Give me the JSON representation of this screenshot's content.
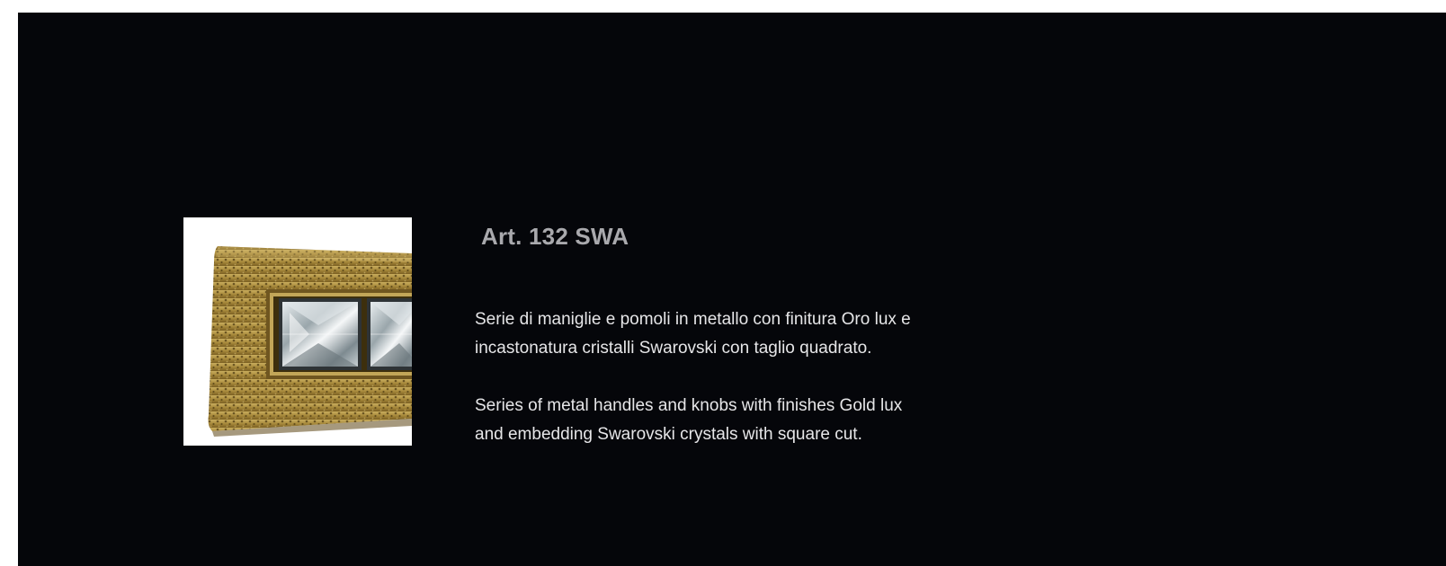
{
  "product": {
    "title": "Art. 132 SWA",
    "image_alt": "Gold lux handle with square Swarovski crystals",
    "description_it": [
      "Serie di maniglie e pomoli in metallo con finitura Oro lux e",
      "incastonatura cristalli Swarovski con taglio quadrato."
    ],
    "description_en": [
      "Series of metal handles and knobs with finishes Gold lux",
      "and embedding Swarovski crystals with square cut."
    ]
  },
  "colors": {
    "background": "#05060a",
    "page": "#ffffff",
    "title": "#a9a9ad",
    "body_text": "#e6e6e8",
    "gold": "#a88a3c"
  }
}
